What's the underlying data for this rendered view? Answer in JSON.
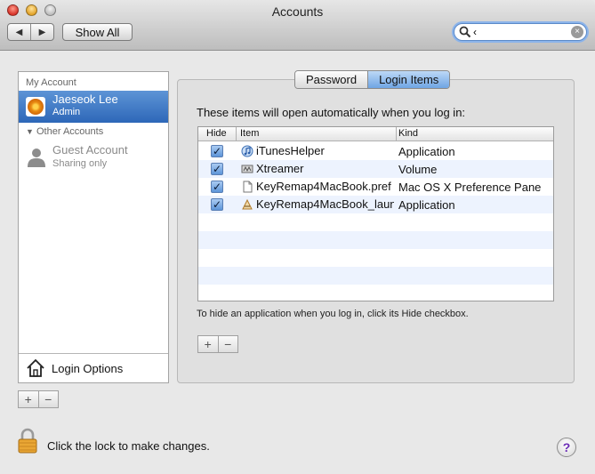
{
  "window": {
    "title": "Accounts"
  },
  "toolbar": {
    "back_glyph": "◀",
    "forward_glyph": "▶",
    "show_all_label": "Show All",
    "search_value": "‹",
    "search_placeholder": "",
    "search_icon": "magnifier-icon",
    "clear_icon": "clear-icon"
  },
  "sidebar": {
    "my_account_header": "My Account",
    "selected_account": {
      "name": "Jaeseok Lee",
      "role": "Admin",
      "icon": "avatar-icon"
    },
    "other_accounts_header": "Other Accounts",
    "other_accounts": [
      {
        "name": "Guest Account",
        "role": "Sharing only",
        "icon": "person-silhouette-icon"
      }
    ],
    "login_options_label": "Login Options",
    "add_label": "+",
    "remove_label": "−"
  },
  "tabs": [
    {
      "label": "Password",
      "active": false
    },
    {
      "label": "Login Items",
      "active": true
    }
  ],
  "login_items": {
    "intro": "These items will open automatically when you log in:",
    "columns": [
      "Hide",
      "Item",
      "Kind"
    ],
    "rows": [
      {
        "hide": true,
        "item": "iTunesHelper",
        "kind": "Application",
        "icon": "itunes-icon"
      },
      {
        "hide": true,
        "item": "Xtreamer",
        "kind": "Volume",
        "icon": "volume-icon"
      },
      {
        "hide": true,
        "item": "KeyRemap4MacBook.pref",
        "kind": "Mac OS X Preference Pane",
        "icon": "document-icon"
      },
      {
        "hide": true,
        "item": "KeyRemap4MacBook_laun",
        "kind": "Application",
        "icon": "app-icon"
      }
    ],
    "hint": "To hide an application when you log in, click its Hide checkbox.",
    "add_label": "+",
    "remove_label": "−"
  },
  "footer": {
    "lock_text": "Click the lock to make changes.",
    "help_label": "?"
  },
  "colors": {
    "selection_blue": "#3c78c6",
    "accent_tab": "#7fb0e8",
    "row_alt": "#edf3fe"
  }
}
